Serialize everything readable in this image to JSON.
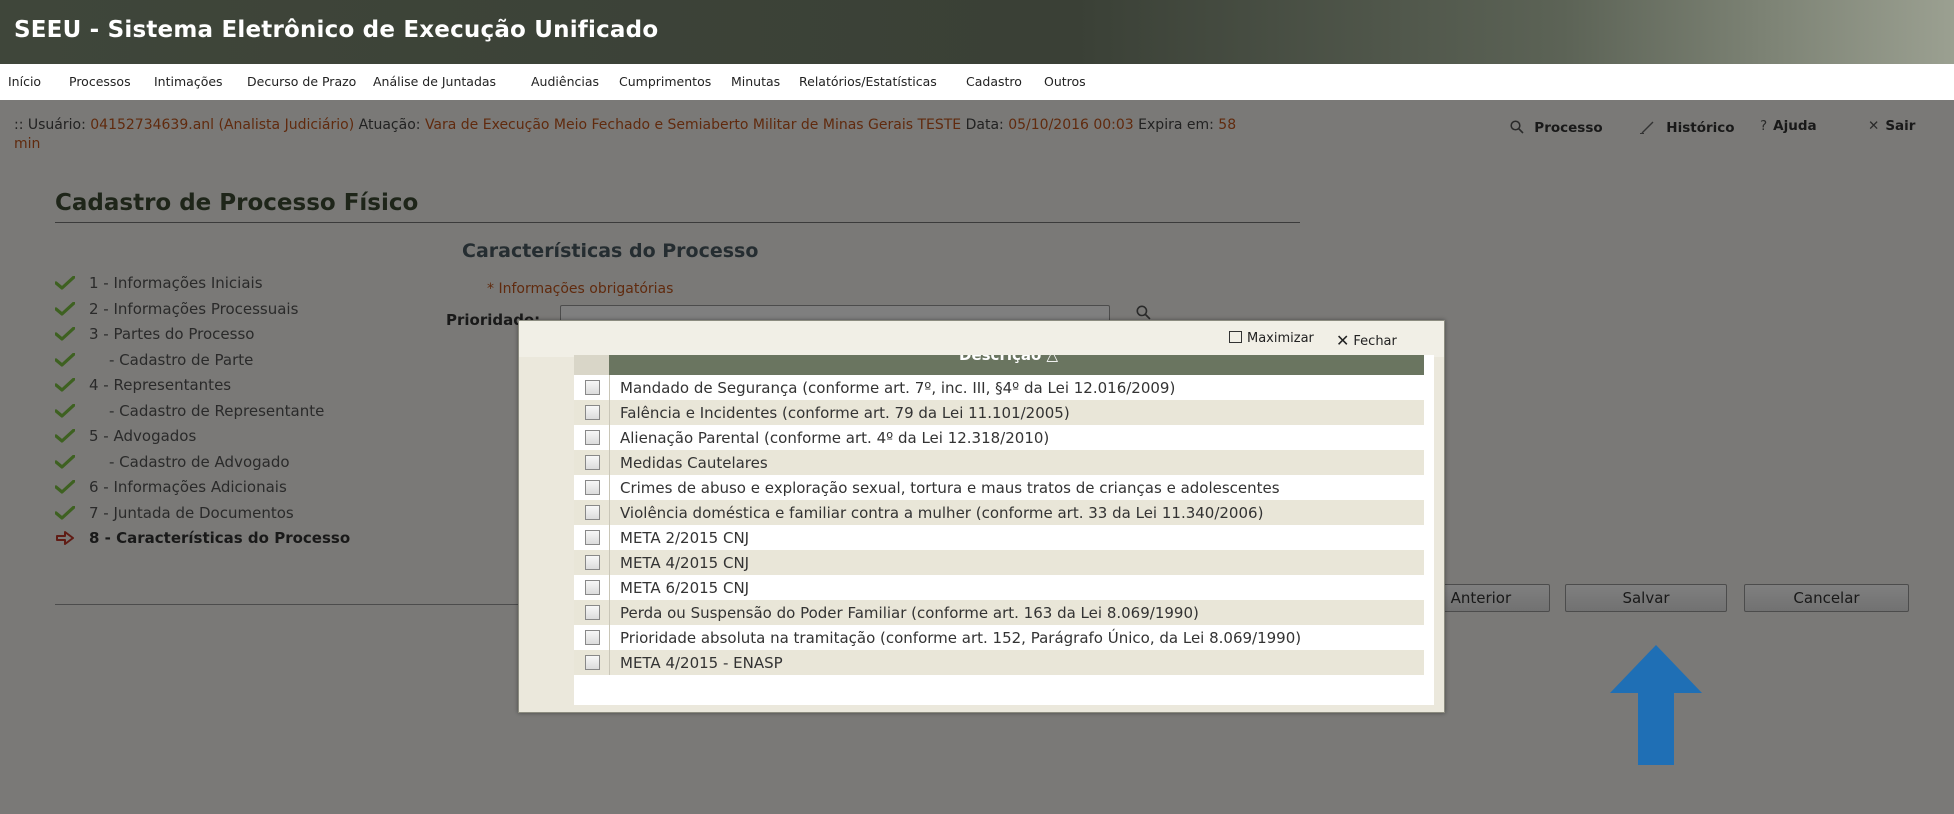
{
  "app": {
    "title": "SEEU - Sistema Eletrônico de Execução Unificado"
  },
  "menu": [
    "Início",
    "Processos",
    "Intimações",
    "Decurso de Prazo",
    "Análise de Juntadas",
    "Audiências",
    "Cumprimentos",
    "Minutas",
    "Relatórios/Estatísticas",
    "Cadastro",
    "Outros"
  ],
  "session": {
    "prefix": ":: Usuário:",
    "user": "04152734639.anl (Analista Judiciário)",
    "atuacao_label": "Atuação:",
    "atuacao": "Vara de Execução Meio Fechado e Semiaberto Militar de Minas Gerais TESTE",
    "data_label": "Data:",
    "data": "05/10/2016 00:03",
    "expira_label": "Expira em:",
    "expira_value": "58",
    "expira_unit": "min"
  },
  "header_links": {
    "processo": "Processo",
    "historico": "Histórico",
    "ajuda": "Ajuda",
    "sair": "Sair"
  },
  "page_title": "Cadastro de Processo Físico",
  "steps": [
    {
      "label": "1 - Informações Iniciais",
      "status": "done"
    },
    {
      "label": "2 - Informações Processuais",
      "status": "done"
    },
    {
      "label": "3 - Partes do Processo",
      "status": "done"
    },
    {
      "label": "- Cadastro de Parte",
      "status": "done"
    },
    {
      "label": "4 - Representantes",
      "status": "done"
    },
    {
      "label": "- Cadastro de Representante",
      "status": "done"
    },
    {
      "label": "5 - Advogados",
      "status": "done"
    },
    {
      "label": "- Cadastro de Advogado",
      "status": "done"
    },
    {
      "label": "6 - Informações Adicionais",
      "status": "done"
    },
    {
      "label": "7 - Juntada de Documentos",
      "status": "done"
    },
    {
      "label": "8 - Características do Processo",
      "status": "current"
    }
  ],
  "section": {
    "title": "Características do Processo",
    "required_note": "* Informações obrigatórias",
    "prioridade_label": "Prioridade:"
  },
  "buttons": {
    "previous": "so Anterior",
    "save": "Salvar",
    "cancel": "Cancelar"
  },
  "dialog": {
    "maximize": "Maximizar",
    "close": "Fechar",
    "column_header": "Descrição",
    "sort_icon": "sort-ascending-icon",
    "items": [
      "Mandado de Segurança (conforme art. 7º, inc. III, §4º da Lei 12.016/2009)",
      "Falência e Incidentes (conforme art. 79 da Lei 11.101/2005)",
      "Alienação Parental (conforme art. 4º da Lei 12.318/2010)",
      "Medidas Cautelares",
      "Crimes de abuso e exploração sexual, tortura e maus tratos de crianças e adolescentes",
      "Violência doméstica e familiar contra a mulher (conforme art. 33 da Lei 11.340/2006)",
      "META 2/2015 CNJ",
      "META 4/2015 CNJ",
      "META 6/2015 CNJ",
      "Perda ou Suspensão do Poder Familiar (conforme art. 163 da Lei 8.069/1990)",
      "Prioridade absoluta na tramitação (conforme art. 152, Parágrafo Único, da Lei 8.069/1990)",
      "META 4/2015 - ENASP"
    ]
  },
  "colors": {
    "topbar": "#3f463a",
    "accent_orange": "#c0551c",
    "check_green": "#7cc242",
    "current_arrow": "#c0392b",
    "highlight_arrow": "#1f6fb5",
    "grid_header": "#6a7560"
  },
  "icons": {
    "step_done": "checkmark-icon",
    "step_current": "right-arrow-icon",
    "processo": "search-icon",
    "historico": "pencil-icon",
    "ajuda": "question-icon",
    "sair": "close-icon"
  }
}
